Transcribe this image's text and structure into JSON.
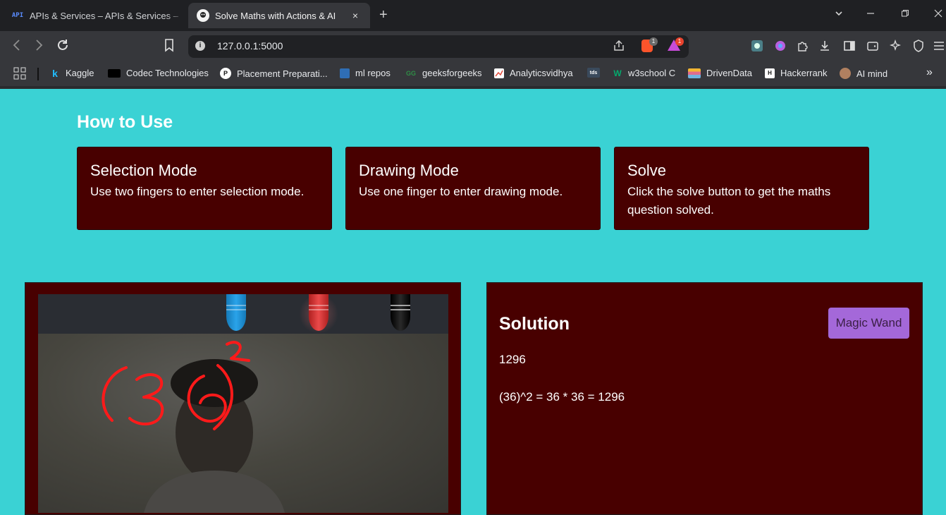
{
  "browser": {
    "tabs": [
      {
        "favicon_text": "API",
        "title": "APIs & Services – APIs & Services –",
        "active": false
      },
      {
        "favicon_text": "",
        "title": "Solve Maths with Actions & AI",
        "active": true
      }
    ],
    "new_tab_icon": "plus-icon",
    "close_icon": "×",
    "url": "127.0.0.1:5000",
    "brave_badge": "1",
    "rewards_badge": "1",
    "bookmarks": [
      {
        "label": "Kaggle",
        "icon_text": "k",
        "color": "#20beff"
      },
      {
        "label": "Codec Technologies",
        "icon_text": "",
        "color": "#000000"
      },
      {
        "label": "Placement Preparati...",
        "icon_text": "P",
        "color": "#ffffff"
      },
      {
        "label": "ml repos",
        "icon_text": "",
        "color": "#2f6eb5"
      },
      {
        "label": "geeksforgeeks",
        "icon_text": "GG",
        "color": "#2f8d46"
      },
      {
        "label": "Analyticsvidhya",
        "icon_text": "",
        "color": "#ffffff"
      },
      {
        "label": "",
        "icon_text": "tds",
        "color": "#3a4a5c"
      },
      {
        "label": "w3school C",
        "icon_text": "W",
        "color": "#04aa6d"
      },
      {
        "label": "DrivenData",
        "icon_text": "",
        "color": "#f2b632"
      },
      {
        "label": "Hackerrank",
        "icon_text": "H",
        "color": "#ffffff"
      },
      {
        "label": "AI mind",
        "icon_text": "",
        "color": "#b08060"
      }
    ],
    "more_bookmarks": "»"
  },
  "page": {
    "heading": "How to Use",
    "cards": [
      {
        "title": "Selection Mode",
        "text": "Use two fingers to enter selection mode."
      },
      {
        "title": "Drawing Mode",
        "text": "Use one finger to enter drawing mode."
      },
      {
        "title": "Solve",
        "text": "Click the solve button to get the maths question solved."
      }
    ],
    "colors": {
      "background": "#3ad2d4",
      "panel": "#480000",
      "button": "#a468d9",
      "ink": "#ff1a1a"
    },
    "crayons": [
      {
        "name": "blue-crayon",
        "color": "#1e8fd6"
      },
      {
        "name": "red-crayon",
        "color": "#e03434"
      },
      {
        "name": "black-crayon",
        "color": "#0a0a0a"
      }
    ],
    "solution": {
      "title": "Solution",
      "button_label": "Magic Wand",
      "answer": "1296",
      "explanation": "(36)^2 = 36 * 36 = 1296"
    }
  }
}
